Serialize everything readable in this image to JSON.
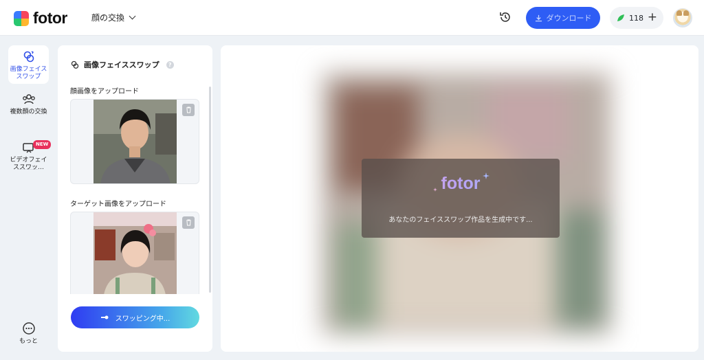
{
  "header": {
    "logo_text": "fotor",
    "tool_selector": "顔の交換",
    "download_label": "ダウンロード",
    "credits": "118",
    "add_credits": "+"
  },
  "nav": {
    "items": [
      {
        "label": "画像フェイススワップ",
        "active": true
      },
      {
        "label": "複数顔の交換"
      },
      {
        "label": "ビデオフェイススワッ…",
        "badge": "NEW"
      },
      {
        "label": "もっと"
      }
    ]
  },
  "panel": {
    "title": "画像フェイススワップ",
    "help": "?",
    "face_label": "顔画像をアップロード",
    "target_label": "ターゲット画像をアップロード",
    "swap_button": "スワッピング中..."
  },
  "canvas": {
    "logo": "fotor",
    "status": "あなたのフェイススワップ作品を生成中です..."
  },
  "colors": {
    "accent": "#2e5df5",
    "nav_active": "#3150e8",
    "badge": "#e8315c"
  }
}
